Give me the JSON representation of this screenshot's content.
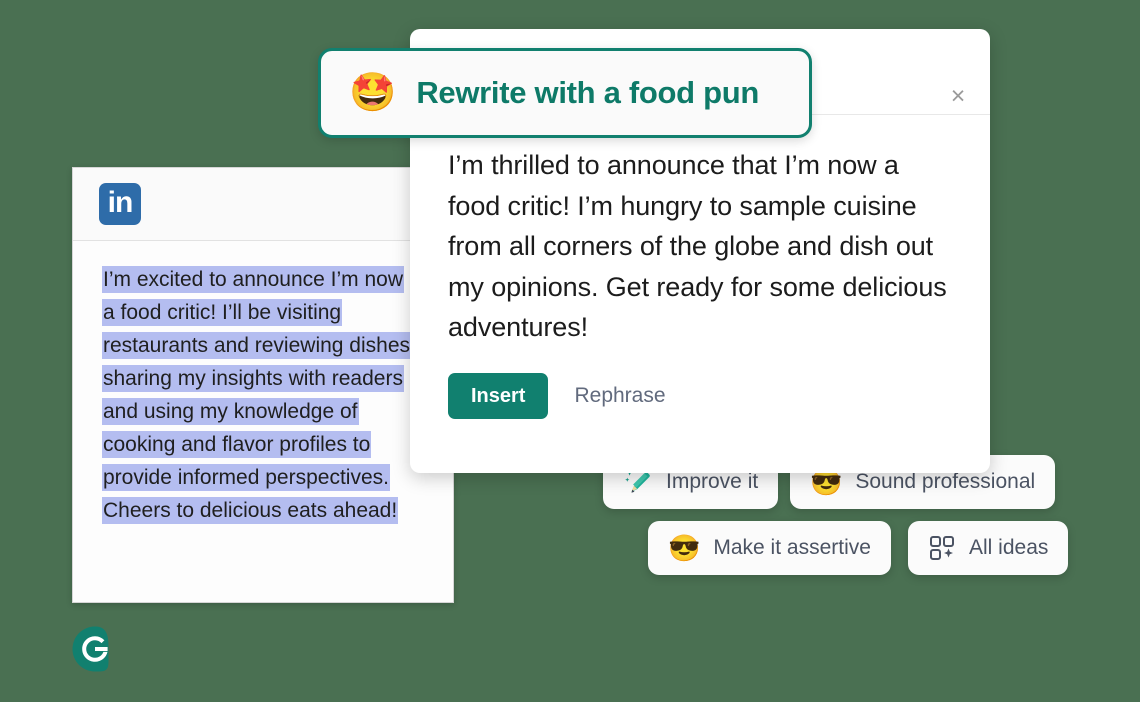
{
  "background_color": "#4a7052",
  "brand": {
    "name": "Grammarly",
    "logo_icon": "grammarly-logo-icon",
    "accent_color": "#11806f"
  },
  "editor_panel": {
    "source_app": "LinkedIn",
    "logo_icon": "linkedin-icon",
    "logo_text": "in",
    "logo_color": "#2e6ca9",
    "highlight_color": "#b4bdf0",
    "selected_text": "I’m excited to announce I’m now a food critic! I’ll be visiting restaurants and reviewing dishes, sharing my insights with readers and using my knowledge of cooking and flavor profiles to provide informed perspectives. Cheers to delicious eats ahead!"
  },
  "header_pill": {
    "emoji": "🤩",
    "emoji_name": "star-struck-emoji",
    "title": "Rewrite with a food pun",
    "border_color": "#11806f",
    "text_color": "#0e7a68"
  },
  "card": {
    "close_icon": "close-icon",
    "close_label": "×",
    "suggestion_text": "I’m thrilled to announce that I’m now a food critic! I’m hungry to sample cuisine from all corners of the globe and dish out my opinions. Get ready for some delicious adventures!",
    "actions": {
      "insert_label": "Insert",
      "rephrase_label": "Rephrase"
    }
  },
  "suggestion_chips": [
    {
      "id": "improve",
      "label": "Improve it",
      "icon": "magic-pencil-icon",
      "emoji": ""
    },
    {
      "id": "professional",
      "label": "Sound professional",
      "icon": "sunglasses-emoji",
      "emoji": "😎"
    },
    {
      "id": "assertive",
      "label": "Make it assertive",
      "icon": "sunglasses-emoji",
      "emoji": "😎"
    },
    {
      "id": "allideas",
      "label": "All ideas",
      "icon": "grid-sparkle-icon",
      "emoji": ""
    }
  ]
}
